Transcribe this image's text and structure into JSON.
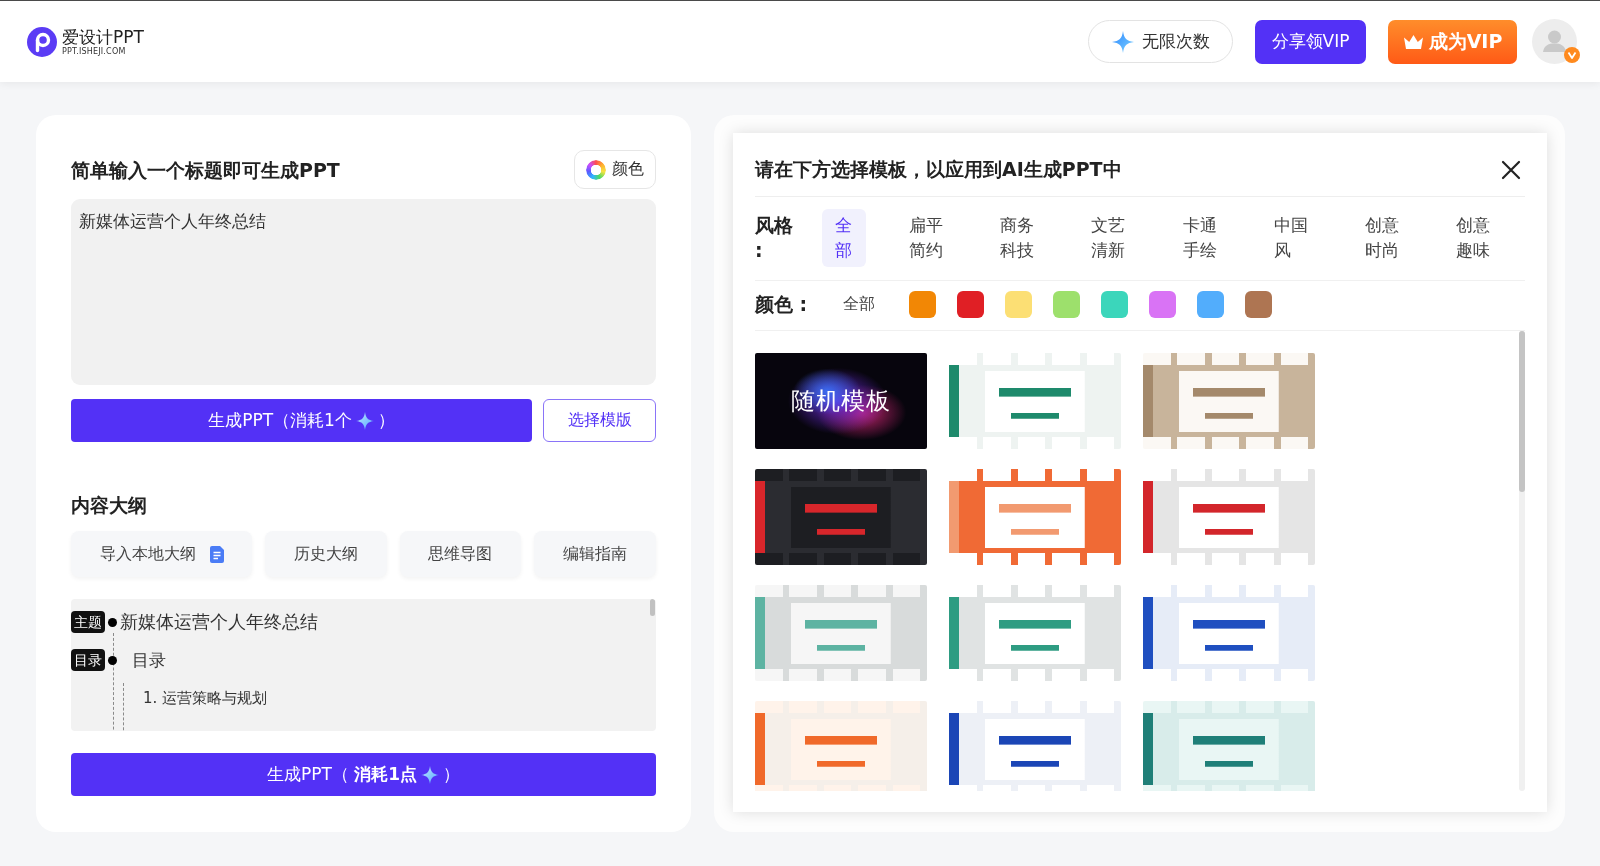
{
  "header": {
    "logo": {
      "name": "爱设计PPT",
      "domain": "PPT.ISHEJI.COM"
    },
    "actions": [
      {
        "kind": "credits",
        "label": "无限次数"
      },
      {
        "kind": "share",
        "label": "分享领VIP"
      },
      {
        "kind": "vip",
        "label": "成为VIP"
      }
    ],
    "avatar": {
      "vip": true
    }
  },
  "generator": {
    "title": "简单输入一个标题即可生成PPT",
    "color_button": "颜色",
    "topic": {
      "value": "新媒体运营个人年终总结"
    },
    "generate_button": {
      "label": "生成PPT（消耗1个",
      "suffix": "）"
    },
    "template_button": "选择模版"
  },
  "outline": {
    "title": "内容大纲",
    "tools": [
      {
        "kind": "import",
        "label": "导入本地大纲"
      },
      {
        "kind": "plain",
        "label": "历史大纲"
      },
      {
        "kind": "plain",
        "label": "思维导图"
      },
      {
        "kind": "plain",
        "label": "编辑指南"
      }
    ],
    "tree": [
      {
        "tag": "主题",
        "text": "新媒体运营个人年终总结",
        "children": [
          {
            "tag": "目录",
            "text": "目录",
            "children": [
              {
                "text": "1. 运营策略与规划"
              }
            ]
          }
        ]
      }
    ],
    "generate_button": {
      "label": "生成PPT（ **消耗1点**",
      "suffix": "）"
    }
  },
  "template_picker": {
    "title": "请在下方选择模板，以应用到AI生成PPT中",
    "style_filter": {
      "label": "风格 :",
      "options": [
        {
          "label": "全部",
          "selected": true
        },
        {
          "label": "扁平简约",
          "selected": false
        },
        {
          "label": "商务科技",
          "selected": false
        },
        {
          "label": "文艺清新",
          "selected": false
        },
        {
          "label": "卡通手绘",
          "selected": false
        },
        {
          "label": "中国风",
          "selected": false
        },
        {
          "label": "创意时尚",
          "selected": false
        },
        {
          "label": "创意趣味",
          "selected": false
        }
      ]
    },
    "color_filter": {
      "label": "颜色 :",
      "all": {
        "label": "全部",
        "selected": false
      },
      "swatches": [
        {
          "color": "#f28705",
          "selected": false
        },
        {
          "color": "#e01f25",
          "selected": false
        },
        {
          "color": "#fcdf74",
          "selected": false
        },
        {
          "color": "#9de06c",
          "selected": false
        },
        {
          "color": "#3bd6bb",
          "selected": false
        },
        {
          "color": "#d973f5",
          "selected": false
        },
        {
          "color": "#52adfc",
          "selected": false
        },
        {
          "color": "#ae7552",
          "selected": false
        }
      ]
    },
    "templates": [
      {
        "kind": "random",
        "label": "随机模板"
      },
      {
        "kind": "preview"
      },
      {
        "kind": "preview"
      },
      {
        "kind": "preview"
      },
      {
        "kind": "preview"
      },
      {
        "kind": "preview"
      },
      {
        "kind": "preview"
      },
      {
        "kind": "preview"
      },
      {
        "kind": "preview"
      },
      {
        "kind": "preview"
      },
      {
        "kind": "preview"
      },
      {
        "kind": "preview"
      }
    ]
  }
}
